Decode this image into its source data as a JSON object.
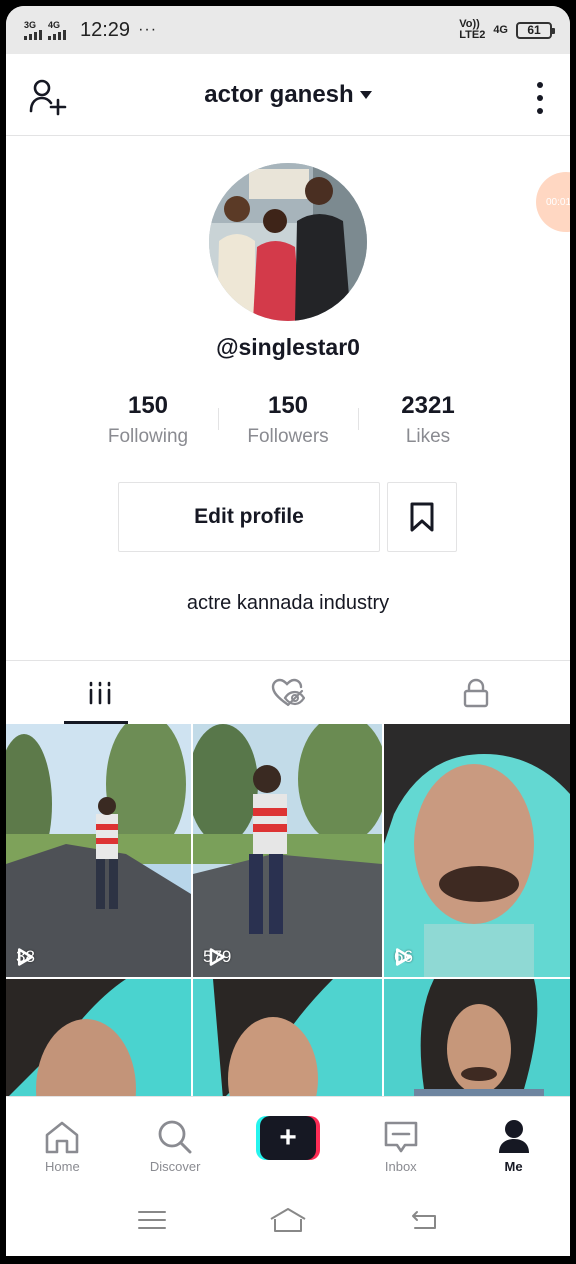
{
  "status_bar": {
    "sim1": "3G",
    "sim2": "4G",
    "time": "12:29",
    "more": "···",
    "volte_top": "Vo))",
    "volte_bottom": "LTE2",
    "net": "4G",
    "battery": "61"
  },
  "header": {
    "title": "actor ganesh"
  },
  "floating_timer": "00:01",
  "profile": {
    "username": "@singlestar0",
    "stats": [
      {
        "value": "150",
        "label": "Following"
      },
      {
        "value": "150",
        "label": "Followers"
      },
      {
        "value": "2321",
        "label": "Likes"
      }
    ],
    "edit_label": "Edit profile",
    "bio": "actre kannada industry"
  },
  "videos": [
    {
      "views": "38"
    },
    {
      "views": "579"
    },
    {
      "views": "66"
    },
    {
      "views": ""
    },
    {
      "views": ""
    },
    {
      "views": ""
    }
  ],
  "bottom_nav": [
    {
      "label": "Home",
      "icon": "home-icon"
    },
    {
      "label": "Discover",
      "icon": "search-icon"
    },
    {
      "label": "",
      "icon": "plus-icon"
    },
    {
      "label": "Inbox",
      "icon": "inbox-icon"
    },
    {
      "label": "Me",
      "icon": "person-icon"
    }
  ],
  "colors": {
    "accent_red": "#fe2c55",
    "accent_cyan": "#25f4ee",
    "text": "#161823",
    "secondary_text": "#8a8b91"
  }
}
